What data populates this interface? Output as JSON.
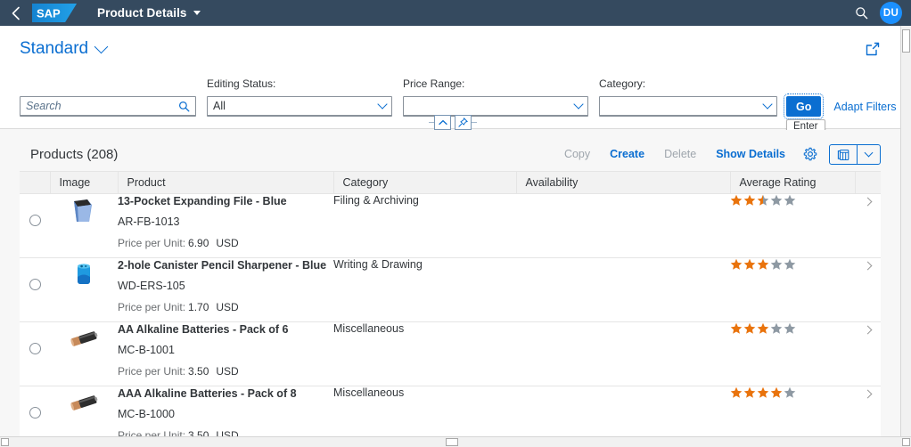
{
  "shell": {
    "back_icon": "chevron-left-icon",
    "logo_text": "SAP",
    "title": "Product Details",
    "search_icon": "search-icon",
    "avatar_initials": "DU",
    "header_bg": "#354a5f",
    "avatar_bg": "#1b90ff"
  },
  "page": {
    "variant_label": "Standard",
    "share_icon": "share-icon"
  },
  "filters": {
    "search": {
      "placeholder": "Search",
      "value": ""
    },
    "editing_status": {
      "label": "Editing Status:",
      "value": "All"
    },
    "price_range": {
      "label": "Price Range:",
      "value": ""
    },
    "category": {
      "label": "Category:",
      "value": ""
    },
    "go_label": "Go",
    "go_tooltip": "Enter",
    "adapt_filters_label": "Adapt Filters",
    "collapse_icon": "chevron-up-icon",
    "pin_icon": "pin-icon",
    "accent": "#0a6ed1"
  },
  "table": {
    "title": "Products (208)",
    "actions": [
      {
        "label": "Copy",
        "disabled": true
      },
      {
        "label": "Create",
        "disabled": false
      },
      {
        "label": "Delete",
        "disabled": true
      },
      {
        "label": "Show Details",
        "disabled": false
      }
    ],
    "settings_icon": "gear-icon",
    "view_icon": "table-view-icon",
    "view_chevron_icon": "chevron-down-icon",
    "columns": [
      "Image",
      "Product",
      "Category",
      "Availability",
      "Average Rating"
    ],
    "price_label": "Price per Unit:",
    "rows": [
      {
        "name": "13-Pocket Expanding File - Blue",
        "id": "AR-FB-1013",
        "category": "Filing & Archiving",
        "availability": "",
        "price": "6.90",
        "currency": "USD",
        "rating": 2.5,
        "thumb": "expanding-file-blue"
      },
      {
        "name": "2-hole Canister Pencil Sharpener - Blue",
        "id": "WD-ERS-105",
        "category": "Writing & Drawing",
        "availability": "",
        "price": "1.70",
        "currency": "USD",
        "rating": 3,
        "thumb": "pencil-sharpener-blue"
      },
      {
        "name": "AA Alkaline Batteries - Pack of 6",
        "id": "MC-B-1001",
        "category": "Miscellaneous",
        "availability": "",
        "price": "3.50",
        "currency": "USD",
        "rating": 3,
        "thumb": "battery-aa"
      },
      {
        "name": "AAA Alkaline Batteries - Pack of 8",
        "id": "MC-B-1000",
        "category": "Miscellaneous",
        "availability": "",
        "price": "3.50",
        "currency": "USD",
        "rating": 4,
        "thumb": "battery-aaa"
      }
    ],
    "star_filled_color": "#e9730c",
    "star_empty_color": "#8e99a3"
  }
}
